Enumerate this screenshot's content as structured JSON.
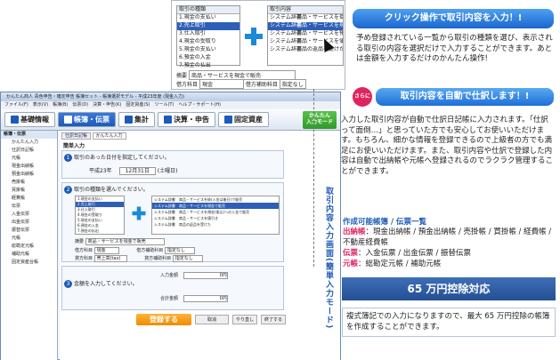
{
  "zoom": {
    "left_header": "取引の種類",
    "left_items": [
      "1.現金の支払い",
      "2.売上取引",
      "3.仕入取引",
      "4.現金の受取り",
      "5.現金の支払い",
      "6.預金の入金",
      "7.預金の払出"
    ],
    "left_selected_index": 1,
    "right_header": "取引内容",
    "right_rows": [
      [
        "システム辞書",
        "商品・サービスを掛(入金は後日)で販売"
      ],
      [
        "システム辞書",
        "商品・サービスを現金で販売"
      ],
      [
        "システム辞書",
        "商品・サービスを預金(振込)への入金で販売"
      ],
      [
        "システム辞書",
        "商品・サービスを値引き"
      ],
      [
        "システム辞書",
        "商品の返品を受けた"
      ]
    ],
    "right_selected_index": 1,
    "summary_label": "摘要",
    "summary_value": "商品・サービスを現金で販売",
    "debit_label": "借方科目",
    "debit_value": "現金",
    "debit_sub_label": "借方補助科目",
    "debit_sub_value": "指定なし",
    "credit_label": "貸方科目",
    "credit_value": "売上高(tax)",
    "credit_sub_label": "貸方補助科目",
    "credit_sub_value": "指定なし"
  },
  "app": {
    "title": "かんたん商人 青色申告・確定申告 帳簿セット - 帳簿選択モデル - 平成23年度 (現金入力)",
    "menu": "ファイル(F)　表示(V)　帳簿(B)　伝票(D)　決算・申告(K)　固定資産(S)　ツール(T)　ヘルプ・サポート(H)",
    "tabs": [
      {
        "label": "基礎情報",
        "active": false
      },
      {
        "label": "帳簿・伝票",
        "active": true
      },
      {
        "label": "集計",
        "active": false
      },
      {
        "label": "決算・申告",
        "active": false
      },
      {
        "label": "固定資産",
        "active": false
      }
    ],
    "kantan_label": "かんたん\n入力モード",
    "side_header": "帳簿・伝票",
    "side_items": [
      "かんたん入力",
      "仕訳日記帳",
      "元帳",
      "現金出納帳",
      "預金出納帳",
      "売掛帳",
      "買掛帳",
      "経費帳",
      "伝票",
      "入金伝票",
      "出金伝票",
      "振替伝票",
      "元帳",
      "総勘定元帳",
      "補助元帳",
      "固定資産台帳"
    ],
    "main_tab1": "仕訳日記帳",
    "main_tab2": "かんたん入力",
    "main_title": "簡単入力",
    "step1_text": "取引のあった日付を指定してください。",
    "step1_year": "平成23年",
    "step1_date": "12月31日",
    "step1_weekday": "(土曜日)",
    "step2_text": "取引の種類を選んでください。",
    "step3_text": "金額を入力してください。",
    "amount_label": "入力金額",
    "amount_value": "0円",
    "tax_label": "合計金額",
    "tax_value": "0円",
    "register_button": "登録する",
    "clear_button": "取消",
    "cancel_button": "やり直し",
    "exit_button": "終了する"
  },
  "vertical_caption": "取引内容入力画面(簡単入力モード)",
  "right": {
    "banner1": "クリック操作で取引内容を入力！!",
    "para1": "予め登録されている一覧から取引の種類を選び、表示される取引の内容を選択だけで入力することができます。あとは金額を入力するだけのかんたん操作!",
    "badge": "さらに",
    "banner2": "取引内容を自動で仕訳します！!",
    "para2": "入力した取引内容が自動で仕訳日記帳に入力されます。「仕訳って面倒…」と思っていた方でも安心してお使いいただけます。もちろん、細かな情報を登録できるので上級者の方でも満足にお使いいただけます。また、取引内容や仕訳で登録した内容は自動で出納帳や元帳へ登録されるのでラクラク管理することができます。",
    "books_title": "作成可能帳簿 / 伝票一覧",
    "books_label": "出納帳",
    "books_text": "：現金出納帳 / 預金出納帳 / 売掛帳 / 買掛帳 / 経費帳 / 不動産経費帳",
    "slips_label": "伝票",
    "slips_text": "：入金伝票 / 出金伝票 / 振替伝票",
    "ledger_label": "元帳",
    "ledger_text": "：総勘定元帳 / 補助元帳",
    "banner3": "65 万円控除対応",
    "para3": "複式簿記での入力になりますので、最大 65 万円控除の帳簿を作成することができます。"
  }
}
